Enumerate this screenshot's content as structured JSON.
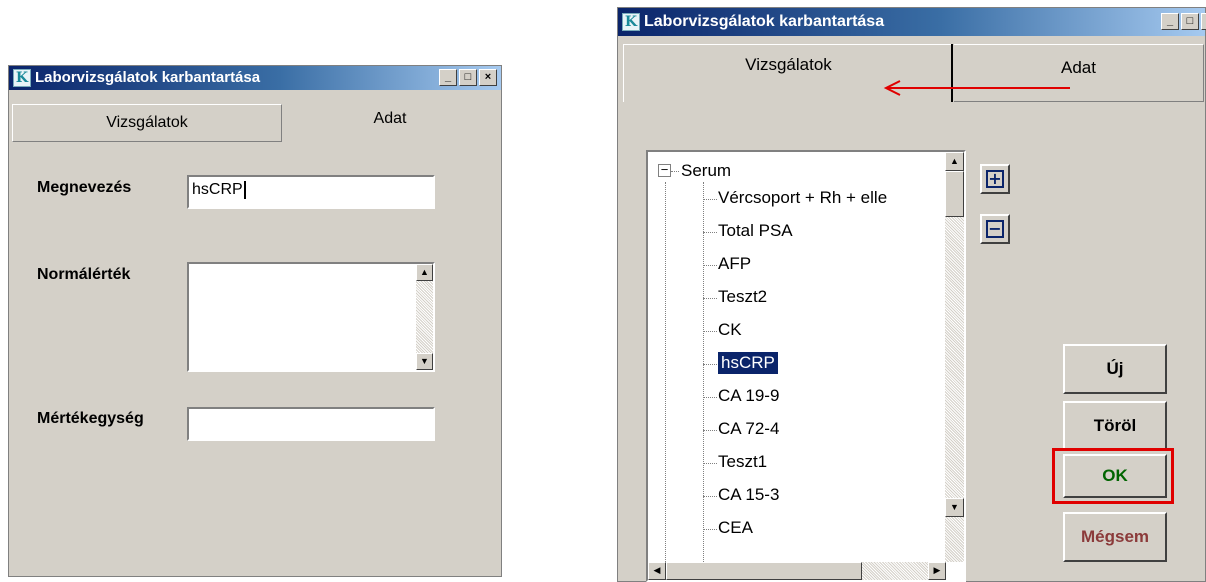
{
  "left_window": {
    "title": "Laborvizsgálatok karbantartása",
    "tabs": [
      "Vizsgálatok",
      "Adat"
    ],
    "fields": {
      "name_label": "Megnevezés",
      "name_value": "hsCRP",
      "normal_label": "Normálérték",
      "normal_value": "",
      "unit_label": "Mértékegység",
      "unit_value": ""
    }
  },
  "right_window": {
    "title": "Laborvizsgálatok karbantartása",
    "tabs": [
      "Vizsgálatok",
      "Adat"
    ],
    "tree": {
      "root": "Serum",
      "items": [
        "Vércsoport + Rh + elle",
        "Total PSA",
        "AFP",
        "Teszt2",
        "CK",
        "hsCRP",
        "CA 19-9",
        "CA 72-4",
        "Teszt1",
        "CA 15-3",
        "CEA"
      ],
      "selected": "hsCRP"
    },
    "buttons": {
      "new": "Új",
      "delete": "Töröl",
      "ok": "OK",
      "cancel": "Mégsem"
    }
  },
  "colors": {
    "title_gradient_start": "#0a246a",
    "window_bg": "#d4d0c8",
    "ok_text": "#006400",
    "cancel_text": "#8b3a3a",
    "annotation_red": "#e00000"
  }
}
